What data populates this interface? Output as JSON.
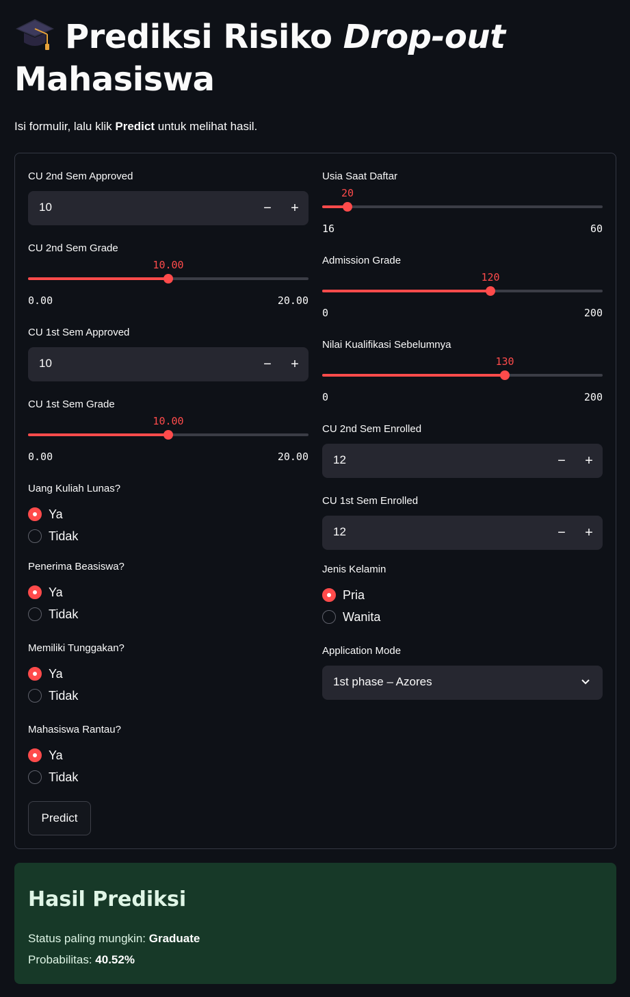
{
  "header": {
    "icon": "graduation-cap-icon",
    "title_part1": "Prediksi Risiko",
    "title_italic": "Drop-out",
    "title_part2": "Mahasiswa",
    "intro_before": "Isi formulir, lalu klik",
    "intro_bold": "Predict",
    "intro_after": "untuk melihat hasil."
  },
  "left": {
    "cu2_approved": {
      "label": "CU 2nd Sem Approved",
      "value": "10"
    },
    "cu2_grade": {
      "label": "CU 2nd Sem Grade",
      "value": "10.00",
      "min": "0.00",
      "max": "20.00",
      "fraction": 0.5
    },
    "cu1_approved": {
      "label": "CU 1st Sem Approved",
      "value": "10"
    },
    "cu1_grade": {
      "label": "CU 1st Sem Grade",
      "value": "10.00",
      "min": "0.00",
      "max": "20.00",
      "fraction": 0.5
    },
    "tuition": {
      "label": "Uang Kuliah Lunas?",
      "options": [
        "Ya",
        "Tidak"
      ],
      "selected": "Ya"
    },
    "scholarship": {
      "label": "Penerima Beasiswa?",
      "options": [
        "Ya",
        "Tidak"
      ],
      "selected": "Ya"
    },
    "debtor": {
      "label": "Memiliki Tunggakan?",
      "options": [
        "Ya",
        "Tidak"
      ],
      "selected": "Ya"
    },
    "displaced": {
      "label": "Mahasiswa Rantau?",
      "options": [
        "Ya",
        "Tidak"
      ],
      "selected": "Ya"
    }
  },
  "right": {
    "age": {
      "label": "Usia Saat Daftar",
      "value": "20",
      "min": "16",
      "max": "60",
      "fraction": 0.0909
    },
    "admission": {
      "label": "Admission Grade",
      "value": "120",
      "min": "0",
      "max": "200",
      "fraction": 0.6
    },
    "prev_qual": {
      "label": "Nilai Kualifikasi Sebelumnya",
      "value": "130",
      "min": "0",
      "max": "200",
      "fraction": 0.65
    },
    "cu2_enrolled": {
      "label": "CU 2nd Sem Enrolled",
      "value": "12"
    },
    "cu1_enrolled": {
      "label": "CU 1st Sem Enrolled",
      "value": "12"
    },
    "gender": {
      "label": "Jenis Kelamin",
      "options": [
        "Pria",
        "Wanita"
      ],
      "selected": "Pria"
    },
    "app_mode": {
      "label": "Application Mode",
      "value": "1st phase – Azores"
    }
  },
  "controls": {
    "minus": "−",
    "plus": "+"
  },
  "predict_label": "Predict",
  "result": {
    "title": "Hasil Prediksi",
    "status_label": "Status paling mungkin:",
    "status_value": "Graduate",
    "prob_label": "Probabilitas:",
    "prob_value": "40.52%"
  },
  "colors": {
    "accent": "#ff4b4b",
    "background": "#0e1117",
    "input_bg": "#262730",
    "success_bg": "#173928"
  }
}
